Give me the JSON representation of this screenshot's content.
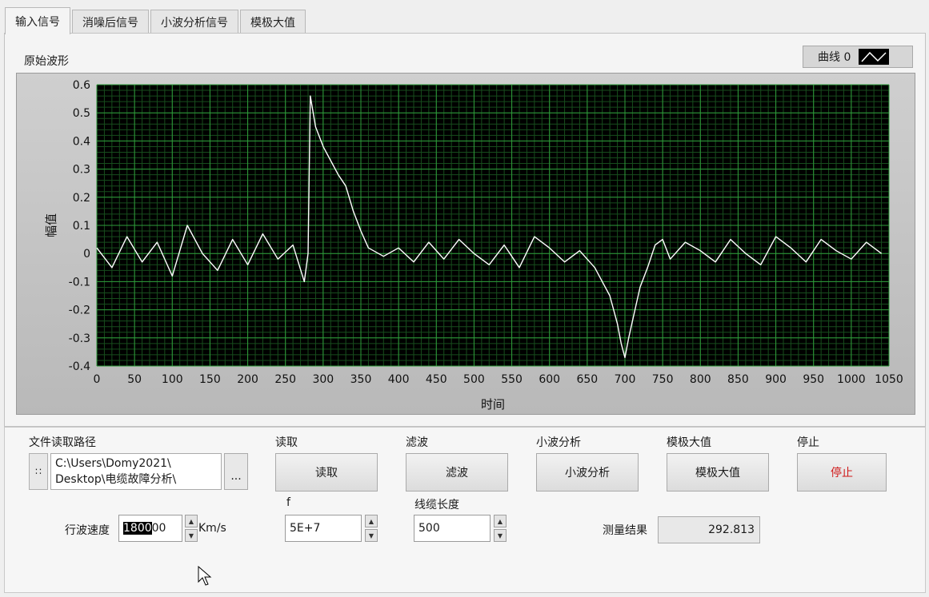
{
  "tabs": [
    "输入信号",
    "消噪后信号",
    "小波分析信号",
    "模极大值"
  ],
  "graph": {
    "label": "原始波形",
    "legend": "曲线 0"
  },
  "chart_data": {
    "type": "line",
    "xlabel": "时间",
    "ylabel": "幅值",
    "xlim": [
      0,
      1050
    ],
    "ylim": [
      -0.4,
      0.6
    ],
    "xticks": [
      0,
      50,
      100,
      150,
      200,
      250,
      300,
      350,
      400,
      450,
      500,
      550,
      600,
      650,
      700,
      750,
      800,
      850,
      900,
      950,
      1000,
      1050
    ],
    "yticks": [
      0.6,
      0.5,
      0.4,
      0.3,
      0.2,
      0.1,
      0,
      -0.1,
      -0.2,
      -0.3,
      -0.4
    ],
    "grid": true,
    "background": "#000000",
    "grid_color": "#2e9b3a",
    "line_color": "#ffffff",
    "series": [
      {
        "name": "曲线 0",
        "x": [
          0,
          20,
          40,
          60,
          80,
          100,
          120,
          140,
          160,
          180,
          200,
          220,
          240,
          260,
          275,
          280,
          283,
          290,
          300,
          310,
          320,
          330,
          340,
          350,
          360,
          380,
          400,
          420,
          440,
          460,
          480,
          500,
          520,
          540,
          560,
          580,
          600,
          620,
          640,
          660,
          670,
          680,
          690,
          695,
          700,
          705,
          710,
          720,
          730,
          740,
          750,
          760,
          780,
          800,
          820,
          840,
          860,
          880,
          900,
          920,
          940,
          960,
          980,
          1000,
          1020,
          1040
        ],
        "y": [
          0.02,
          -0.05,
          0.06,
          -0.03,
          0.04,
          -0.08,
          0.1,
          0.0,
          -0.06,
          0.05,
          -0.04,
          0.07,
          -0.02,
          0.03,
          -0.1,
          0.0,
          0.56,
          0.45,
          0.38,
          0.33,
          0.28,
          0.24,
          0.15,
          0.08,
          0.02,
          -0.01,
          0.02,
          -0.03,
          0.04,
          -0.02,
          0.05,
          0.0,
          -0.04,
          0.03,
          -0.05,
          0.06,
          0.02,
          -0.03,
          0.01,
          -0.05,
          -0.1,
          -0.15,
          -0.25,
          -0.32,
          -0.37,
          -0.3,
          -0.24,
          -0.12,
          -0.05,
          0.03,
          0.05,
          -0.02,
          0.04,
          0.01,
          -0.03,
          0.05,
          0.0,
          -0.04,
          0.06,
          0.02,
          -0.03,
          0.05,
          0.01,
          -0.02,
          0.04,
          0.0
        ]
      }
    ]
  },
  "controls": {
    "path_label": "文件读取路径",
    "path_line1": "C:\\Users\\Domy2021\\",
    "path_line2": "Desktop\\电缆故障分析\\",
    "browse_dots": "...",
    "read_label": "读取",
    "read_button": "读取",
    "filter_label": "滤波",
    "filter_button": "滤波",
    "wavelet_label": "小波分析",
    "wavelet_button": "小波分析",
    "modmax_label": "模极大值",
    "modmax_button": "模极大值",
    "stop_label": "停止",
    "stop_button": "停止",
    "speed_label": "行波速度",
    "speed_value_selected": "1800",
    "speed_value_rest": "00",
    "speed_unit": "Km/s",
    "f_label": "f",
    "f_value": "5E+7",
    "cable_label": "线缆长度",
    "cable_value": "500",
    "result_label": "测量结果",
    "result_value": "292.813"
  }
}
